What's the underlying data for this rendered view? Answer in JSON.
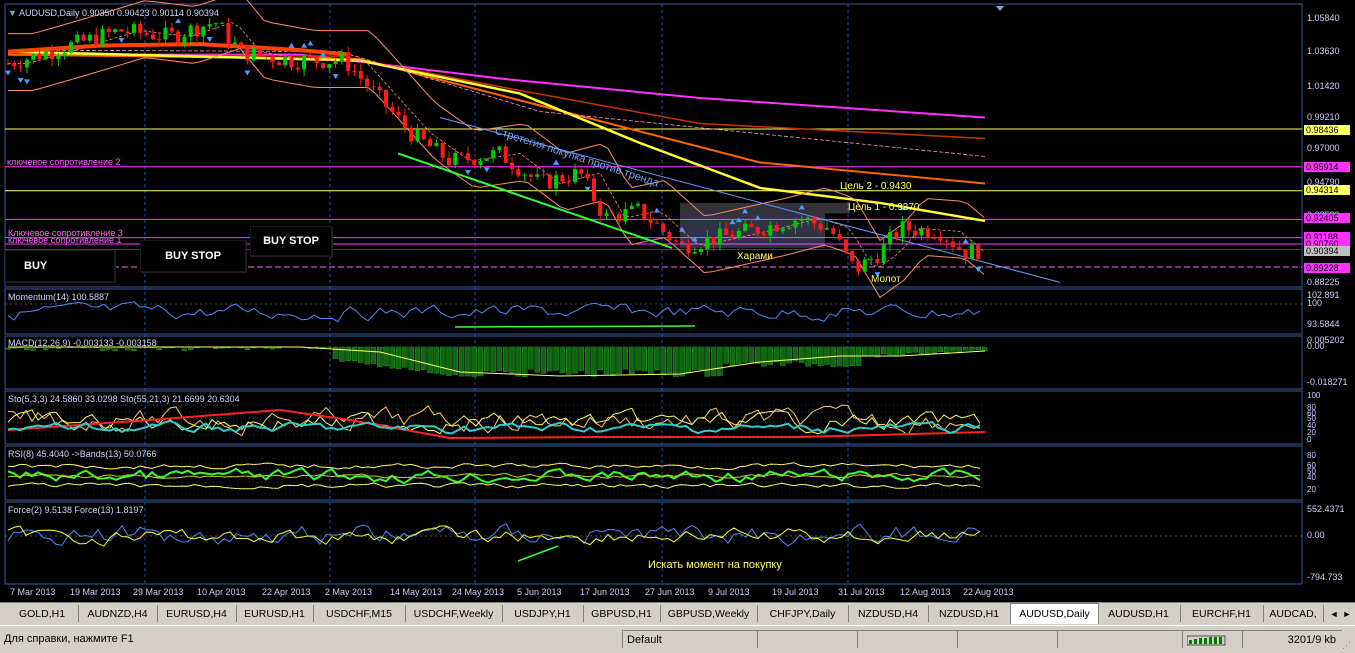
{
  "window": {
    "symbol_title": "AUDUSD,Daily",
    "ohlc": "0.90350 0.90423 0.90114 0.90394"
  },
  "price_axis": {
    "labels": [
      "1.05840",
      "1.03630",
      "1.01420",
      "0.99210",
      "0.97000",
      "0.94790",
      "0.92580",
      "0.90370",
      "0.88225"
    ],
    "tags": [
      {
        "text": "0.98436",
        "bg": "#ffff66"
      },
      {
        "text": "0.95914",
        "bg": "#ff33ff"
      },
      {
        "text": "0.94314",
        "bg": "#ffff66"
      },
      {
        "text": "0.92405",
        "bg": "#ff33ff"
      },
      {
        "text": "0.91188",
        "bg": "#ff33ff"
      },
      {
        "text": "0.90760",
        "bg": "#ff33ff"
      },
      {
        "text": "0.90394",
        "bg": "#c0c0c0"
      },
      {
        "text": "0.89228",
        "bg": "#ff33ff"
      }
    ]
  },
  "levels": {
    "resistance_2": "ключевое сопротивление 2",
    "resistance_3": "Ключевое сопротивление 3",
    "resistance_1": "ключевое сопротивление 1"
  },
  "annotations": {
    "strategy": "Стретегия покупка против тренда",
    "target2": "Цель 2 - 0.9430",
    "target1": "Цель 1 - 0.9370",
    "harami": "Харами",
    "hammer": "Молот",
    "seek": "Искать момент на покупку"
  },
  "order_buttons": {
    "buy": "BUY",
    "buy_stop_1": "BUY STOP",
    "buy_stop_2": "BUY STOP"
  },
  "panes": {
    "momentum": {
      "title": "Momentum(14) 100.5887",
      "axis": [
        "102.891",
        "100",
        "93.5844"
      ]
    },
    "macd": {
      "title": "MACD(12,26,9) -0.003133 -0.003158",
      "axis": [
        "0.005202",
        "0.00",
        "-0.018271"
      ]
    },
    "stoch": {
      "title": "Sto(5,3,3) 24.5860 33.0298  Sto(55,21,3) 21.6699 20.6304",
      "axis": [
        "100",
        "80",
        "60",
        "50",
        "40",
        "20",
        "0"
      ]
    },
    "rsi": {
      "title": "RSI(8) 45.4040  ->Bands(13) 50.0766",
      "axis": [
        "80",
        "60",
        "50",
        "40",
        "20"
      ]
    },
    "force": {
      "title": "Force(2) 9.5138  Force(13) 1.8197",
      "axis": [
        "552.4371",
        "0.00",
        "-794.733"
      ]
    }
  },
  "time_axis": [
    "7 Mar 2013",
    "19 Mar 2013",
    "29 Mar 2013",
    "10 Apr 2013",
    "22 Apr 2013",
    "2 May 2013",
    "14 May 2013",
    "24 May 2013",
    "5 Jun 2013",
    "17 Jun 2013",
    "27 Jun 2013",
    "9 Jul 2013",
    "19 Jul 2013",
    "31 Jul 2013",
    "12 Aug 2013",
    "22 Aug 2013"
  ],
  "tabs": [
    "GOLD,H1",
    "AUDNZD,H4",
    "EURUSD,H4",
    "EURUSD,H1",
    "USDCHF,M15",
    "USDCHF,Weekly",
    "USDJPY,H1",
    "GBPUSD,H1",
    "GBPUSD,Weekly",
    "CHFJPY,Daily",
    "NZDUSD,H4",
    "NZDUSD,H1",
    "AUDUSD,Daily",
    "AUDUSD,H1",
    "EURCHF,H1",
    "AUDCAD,"
  ],
  "active_tab": "AUDUSD,Daily",
  "status": {
    "help": "Для справки, нажмите F1",
    "profile": "Default",
    "traffic": "3201/9 kb"
  },
  "colors": {
    "bull": "#00cc00",
    "bear": "#ff1a1a",
    "yellow_level": "#ffff66",
    "magenta_level": "#ff33ff",
    "axis_text": "#d0d0ff"
  }
}
